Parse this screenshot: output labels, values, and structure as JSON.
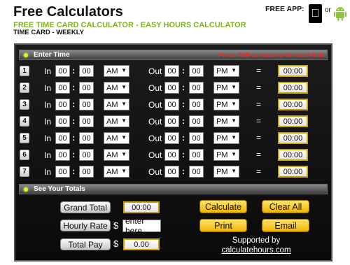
{
  "header": {
    "site_title": "Free Calculators",
    "free_app_label": "FREE APP:",
    "or_label": "or",
    "subtitle": "FREE TIME CARD CALCULATOR - EASY HOURS CALCULATOR",
    "sub_subtitle": "TIME CARD - WEEKLY"
  },
  "enter_time": {
    "title": "Enter Time",
    "hint": "Press TAB to move to the next field",
    "in_label": "In",
    "out_label": "Out",
    "colon": ":",
    "equals": "=",
    "rows": [
      {
        "num": "1",
        "in_h": "00",
        "in_m": "00",
        "in_ampm": "AM",
        "out_h": "00",
        "out_m": "00",
        "out_ampm": "PM",
        "total": "00:00"
      },
      {
        "num": "2",
        "in_h": "00",
        "in_m": "00",
        "in_ampm": "AM",
        "out_h": "00",
        "out_m": "00",
        "out_ampm": "PM",
        "total": "00:00"
      },
      {
        "num": "3",
        "in_h": "00",
        "in_m": "00",
        "in_ampm": "AM",
        "out_h": "00",
        "out_m": "00",
        "out_ampm": "PM",
        "total": "00:00"
      },
      {
        "num": "4",
        "in_h": "00",
        "in_m": "00",
        "in_ampm": "AM",
        "out_h": "00",
        "out_m": "00",
        "out_ampm": "PM",
        "total": "00:00"
      },
      {
        "num": "5",
        "in_h": "00",
        "in_m": "00",
        "in_ampm": "AM",
        "out_h": "00",
        "out_m": "00",
        "out_ampm": "PM",
        "total": "00:00"
      },
      {
        "num": "6",
        "in_h": "00",
        "in_m": "00",
        "in_ampm": "AM",
        "out_h": "00",
        "out_m": "00",
        "out_ampm": "PM",
        "total": "00:00"
      },
      {
        "num": "7",
        "in_h": "00",
        "in_m": "00",
        "in_ampm": "AM",
        "out_h": "00",
        "out_m": "00",
        "out_ampm": "PM",
        "total": "00:00"
      }
    ]
  },
  "totals": {
    "title": "See Your Totals",
    "grand_total_label": "Grand Total",
    "grand_total_value": "00:00",
    "hourly_rate_label": "Hourly Rate",
    "currency_symbol": "$",
    "hourly_rate_placeholder": "enter here",
    "total_pay_label": "Total Pay",
    "total_pay_value": "0.00"
  },
  "buttons": {
    "calculate": "Calculate",
    "clear_all": "Clear All",
    "print": "Print",
    "email": "Email"
  },
  "footer": {
    "supported_by": "Supported by",
    "link": "calculatehours.com"
  },
  "colors": {
    "subtitle_green": "#7db51d",
    "hint_red": "#ff2020",
    "button_yellow": "#f7c300",
    "total_border": "#c9a20c"
  },
  "icons": {
    "apple": "apple-icon",
    "android": "android-icon",
    "bar_dot": "green-dot-icon",
    "dropdown": "dropdown-arrow-icon"
  }
}
